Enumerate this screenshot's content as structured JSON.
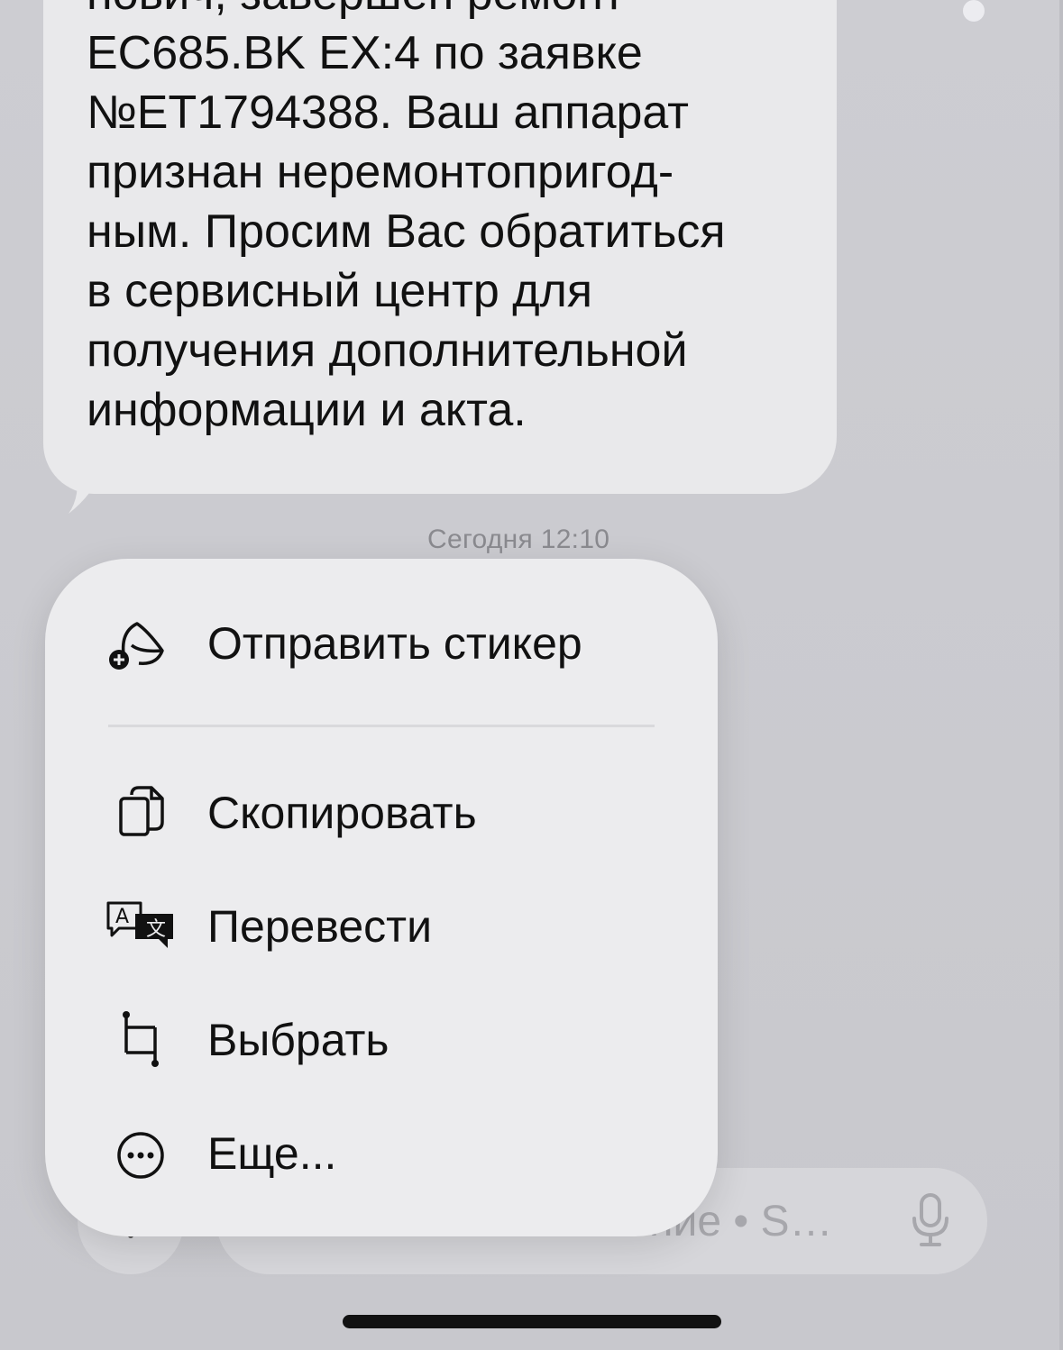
{
  "message": {
    "lines": [
      "нович, завершён ремонт",
      "EC685.BK EX:4 по заявке",
      "№ET1794388. Ваш аппарат",
      "признан неремонтопригод-",
      "ным. Просим Вас обратиться",
      "в сервисный центр для",
      "получения дополнительной",
      "информации и акта."
    ],
    "timestamp": "Сегодня 12:10"
  },
  "menu": {
    "items": [
      {
        "label": "Отправить стикер",
        "icon": "sticker-add-icon"
      },
      {
        "label": "Скопировать",
        "icon": "copy-icon"
      },
      {
        "label": "Перевести",
        "icon": "translate-icon"
      },
      {
        "label": "Выбрать",
        "icon": "select-crop-icon"
      },
      {
        "label": "Еще...",
        "icon": "more-ellipsis-icon"
      }
    ]
  },
  "input": {
    "placeholder_visible": "ние • S…",
    "mic_icon": "microphone-icon",
    "plus_icon": "plus-icon"
  },
  "colors": {
    "background": "#c9c9ce",
    "bubble": "#e9e9eb",
    "menu": "#ececee",
    "text": "#111111",
    "secondary_text": "#8a8a8f"
  }
}
